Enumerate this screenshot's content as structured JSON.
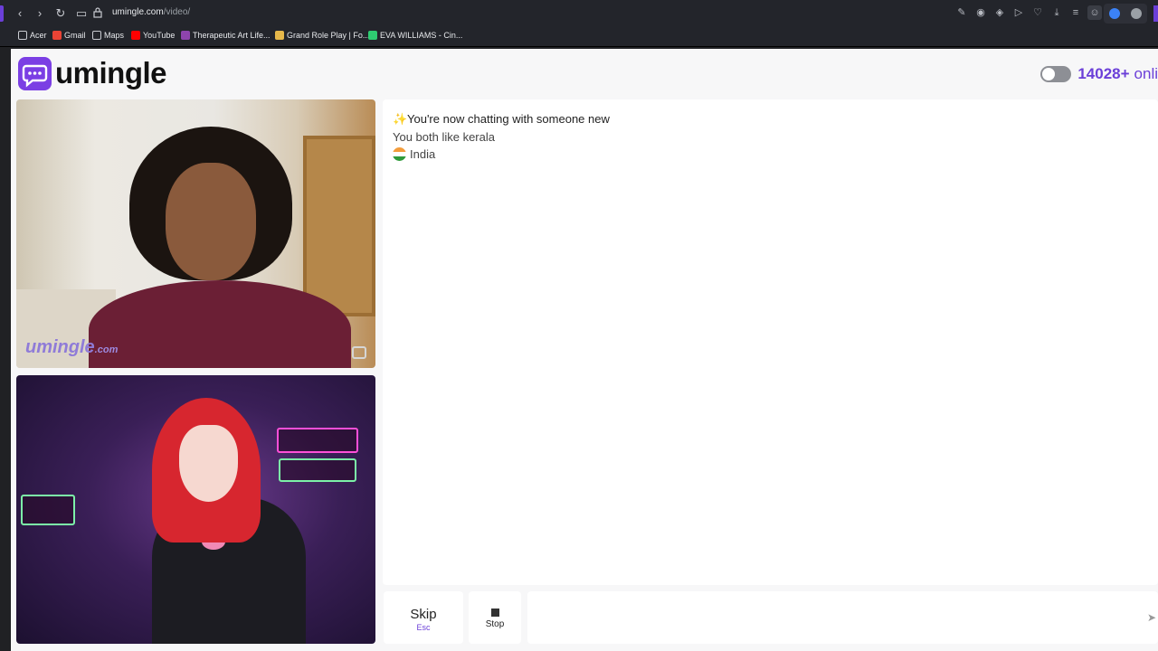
{
  "browser": {
    "url_host": "umingle.com",
    "url_path": "/video/",
    "bookmarks": [
      {
        "label": "Acer",
        "icon": "folder-icon",
        "color": "#c9cbd1"
      },
      {
        "label": "Gmail",
        "icon": "gmail-icon",
        "color": "#ea4335"
      },
      {
        "label": "Maps",
        "icon": "maps-icon",
        "color": "#c9cbd1"
      },
      {
        "label": "YouTube",
        "icon": "youtube-icon",
        "color": "#ff0000"
      },
      {
        "label": "Therapeutic Art Life...",
        "icon": "site-icon",
        "color": "#8e44ad"
      },
      {
        "label": "Grand Role Play | Fo...",
        "icon": "site-icon",
        "color": "#e6b84a"
      },
      {
        "label": "EVA WILLIAMS - Cin...",
        "icon": "site-icon",
        "color": "#2ecc71"
      }
    ]
  },
  "header": {
    "logo_text": "umingle",
    "online_count": "14028+",
    "online_suffix": "onli"
  },
  "remote_video": {
    "watermark_brand": "umingle",
    "watermark_domain": ".com"
  },
  "chat": {
    "messages": [
      {
        "icon": "sparkle-icon",
        "text": "You're now chatting with someone new"
      },
      {
        "text": "You both like kerala"
      },
      {
        "icon": "india-flag-icon",
        "text": "India"
      }
    ]
  },
  "controls": {
    "skip_label": "Skip",
    "skip_shortcut": "Esc",
    "stop_label": "Stop",
    "message_value": ""
  },
  "colors": {
    "brand": "#7b3fe4",
    "accent_text": "#6b3fd8"
  }
}
